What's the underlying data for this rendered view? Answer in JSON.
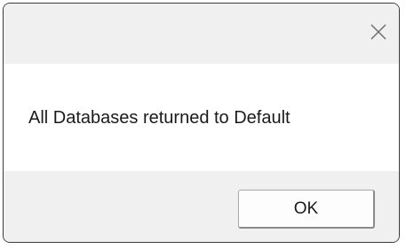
{
  "dialog": {
    "message": "All Databases returned to Default",
    "ok_label": "OK",
    "close_icon": "close-icon"
  },
  "colors": {
    "titlebar_bg": "#f0f0f0",
    "content_bg": "#ffffff",
    "footer_bg": "#f0f0f0",
    "text": "#1a1a1a"
  }
}
